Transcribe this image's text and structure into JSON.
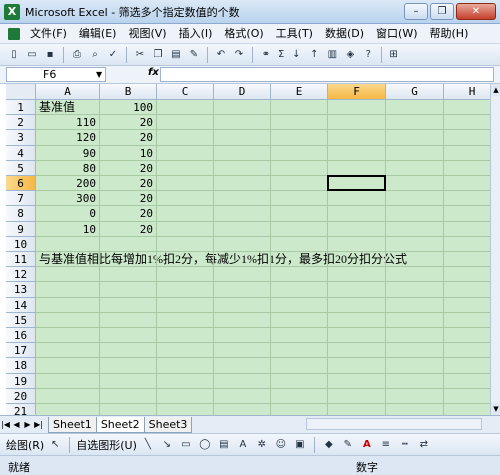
{
  "window": {
    "title": "Microsoft Excel - 筛选多个指定数值的个数",
    "app_icon": "X",
    "buttons": {
      "minimize": "–",
      "restore": "❐",
      "close": "✕"
    }
  },
  "menu": {
    "items": [
      "文件(F)",
      "编辑(E)",
      "视图(V)",
      "插入(I)",
      "格式(O)",
      "工具(T)",
      "数据(D)",
      "窗口(W)",
      "帮助(H)"
    ]
  },
  "toolbar": {
    "sigma": "Σ",
    "zoom_hint": "⊞"
  },
  "formula_bar": {
    "name_box": "F6",
    "fx": "fx",
    "content": ""
  },
  "columns": [
    "A",
    "B",
    "C",
    "D",
    "E",
    "F",
    "G",
    "H"
  ],
  "selected_column": "F",
  "selected_row": "6",
  "rows": [
    {
      "n": "1",
      "A": "基准值",
      "B": "100"
    },
    {
      "n": "2",
      "A": "110",
      "B": "20"
    },
    {
      "n": "3",
      "A": "120",
      "B": "20"
    },
    {
      "n": "4",
      "A": "90",
      "B": "10"
    },
    {
      "n": "5",
      "A": "80",
      "B": "20"
    },
    {
      "n": "6",
      "A": "200",
      "B": "20"
    },
    {
      "n": "7",
      "A": "300",
      "B": "20"
    },
    {
      "n": "8",
      "A": "0",
      "B": "20"
    },
    {
      "n": "9",
      "A": "10",
      "B": "20"
    },
    {
      "n": "10",
      "A": "",
      "B": ""
    },
    {
      "n": "11",
      "A": "与基准值相比每增加1%扣2分，每减少1%扣1分，最多扣20分扣分公式",
      "B": ""
    },
    {
      "n": "12",
      "A": "",
      "B": ""
    },
    {
      "n": "13",
      "A": "",
      "B": ""
    },
    {
      "n": "14",
      "A": "",
      "B": ""
    },
    {
      "n": "15",
      "A": "",
      "B": ""
    },
    {
      "n": "16",
      "A": "",
      "B": ""
    },
    {
      "n": "17",
      "A": "",
      "B": ""
    },
    {
      "n": "18",
      "A": "",
      "B": ""
    },
    {
      "n": "19",
      "A": "",
      "B": ""
    },
    {
      "n": "20",
      "A": "",
      "B": ""
    },
    {
      "n": "21",
      "A": "",
      "B": ""
    }
  ],
  "sheets": [
    "Sheet1",
    "Sheet2",
    "Sheet3"
  ],
  "active_sheet": "Sheet2",
  "drawing_toolbar": {
    "draw_label": "绘图(R)",
    "autoshape_label": "自选图形(U)"
  },
  "status": {
    "left": "就绪",
    "mode": "数字"
  },
  "colors": {
    "cell_bg": "#cde9cc",
    "grid_line": "#a9c9a5",
    "header_selected": "#f6b744"
  }
}
